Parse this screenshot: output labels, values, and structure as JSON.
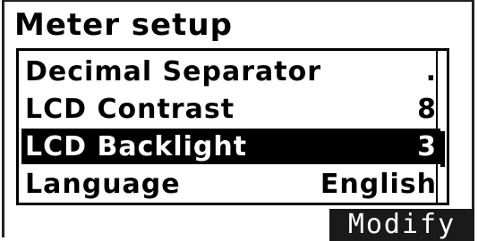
{
  "screen": {
    "title": "Meter setup"
  },
  "menu": {
    "items": [
      {
        "label": "Decimal Separator",
        "value": "."
      },
      {
        "label": "LCD Contrast",
        "value": "8"
      },
      {
        "label": "LCD Backlight",
        "value": "3"
      },
      {
        "label": "Language",
        "value": "English"
      }
    ],
    "selected_index": 2
  },
  "softkeys": {
    "right_label": "Modify"
  },
  "colors": {
    "foreground": "#000000",
    "background": "#ffffff",
    "selection": "#000000"
  }
}
